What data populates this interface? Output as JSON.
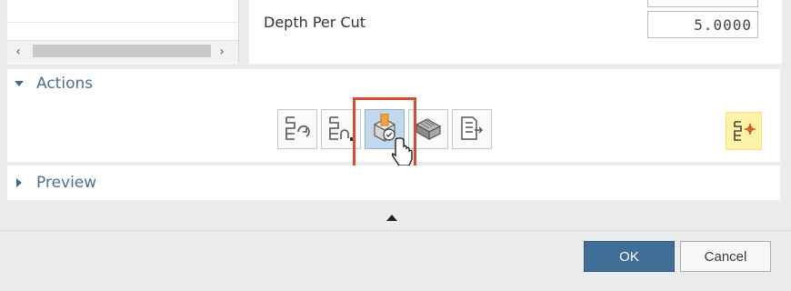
{
  "fields": {
    "depth_per_cut": {
      "label": "Depth Per Cut",
      "value": "5.0000"
    }
  },
  "actions": {
    "title": "Actions",
    "buttons": [
      {
        "icon": "regenerate-tool-path-icon",
        "active": false
      },
      {
        "icon": "generate-tool-path-icon",
        "active": false
      },
      {
        "icon": "verify-tool-path-icon",
        "active": true
      },
      {
        "icon": "simulate-icon",
        "active": false
      },
      {
        "icon": "list-tool-path-icon",
        "active": false
      }
    ],
    "side_button": {
      "icon": "operation-navigator-icon",
      "color": "#fff3a7"
    }
  },
  "preview": {
    "title": "Preview"
  },
  "footer": {
    "ok_label": "OK",
    "cancel_label": "Cancel"
  },
  "colors": {
    "accent": "#3f6d95",
    "highlight_box": "#dc4a32",
    "section_header": "#4a6f93"
  }
}
